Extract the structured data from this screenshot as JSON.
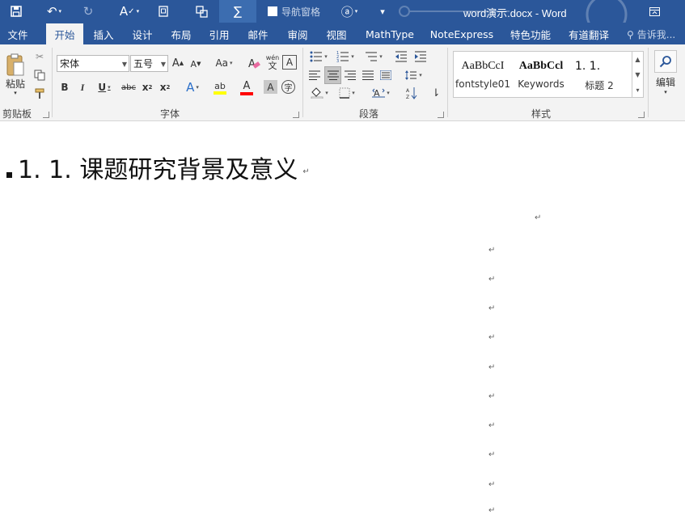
{
  "window": {
    "title": "word演示.docx - Word",
    "nav_pane_label": "导航窗格"
  },
  "tabs": [
    {
      "label": "文件"
    },
    {
      "label": "开始"
    },
    {
      "label": "插入"
    },
    {
      "label": "设计"
    },
    {
      "label": "布局"
    },
    {
      "label": "引用"
    },
    {
      "label": "邮件"
    },
    {
      "label": "审阅"
    },
    {
      "label": "视图"
    },
    {
      "label": "MathType"
    },
    {
      "label": "NoteExpress"
    },
    {
      "label": "特色功能"
    },
    {
      "label": "有道翻译"
    }
  ],
  "tell_me": "告诉我...",
  "ribbon": {
    "clipboard": {
      "paste_label": "粘贴",
      "group": "剪贴板"
    },
    "font": {
      "name": "宋体",
      "size": "五号",
      "group": "字体",
      "change_case": "Aa",
      "phonetic_top": "wén",
      "phonetic_bottom": "文"
    },
    "paragraph": {
      "group": "段落"
    },
    "styles": {
      "group": "样式",
      "items": [
        {
          "sample": "AaBbCcI",
          "name": "fontstyle01"
        },
        {
          "sample": "AaBbCcl",
          "name": "Keywords"
        },
        {
          "sample": "1. 1.",
          "name": "标题 2"
        }
      ]
    },
    "editing": {
      "label": "编辑"
    }
  },
  "document": {
    "heading": "1. 1. 课题研究背景及意义",
    "paragraph_mark": "↵"
  },
  "colors": {
    "brand": "#2b579a",
    "highlight": "#ffff00",
    "font_color": "#ff0000"
  }
}
